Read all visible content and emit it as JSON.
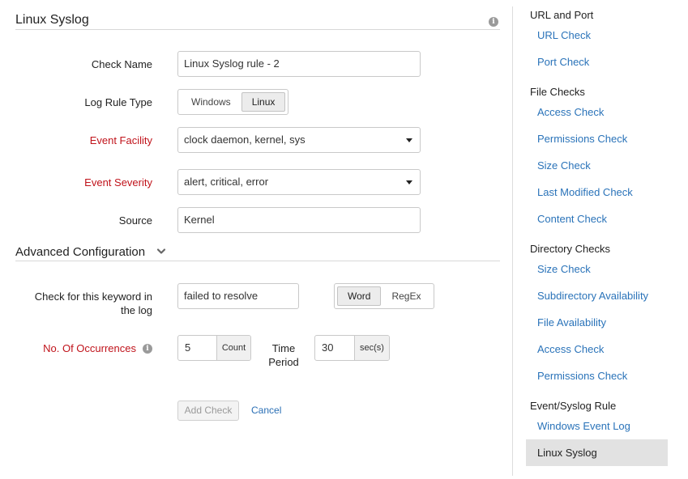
{
  "form": {
    "title": "Linux Syslog",
    "check_name_label": "Check Name",
    "check_name_value": "Linux Syslog rule - 2",
    "log_rule_type_label": "Log Rule Type",
    "log_rule_type_options": [
      "Windows",
      "Linux"
    ],
    "log_rule_type_selected": "Linux",
    "event_facility_label": "Event Facility",
    "event_facility_value": "clock daemon, kernel, sys",
    "event_severity_label": "Event Severity",
    "event_severity_value": "alert, critical, error",
    "source_label": "Source",
    "source_value": "Kernel"
  },
  "advanced": {
    "title": "Advanced Configuration",
    "keyword_label_line1": "Check for this keyword in",
    "keyword_label_line2": "the log",
    "keyword_value": "failed to resolve",
    "match_mode_options": [
      "Word",
      "RegEx"
    ],
    "match_mode_selected": "Word",
    "occurrences_label": "No. Of Occurrences",
    "occurrences_value": "5",
    "occurrences_unit": "Count",
    "time_period_label_line1": "Time",
    "time_period_label_line2": "Period",
    "time_period_value": "30",
    "time_period_unit": "sec(s)"
  },
  "actions": {
    "add_check": "Add Check",
    "cancel": "Cancel"
  },
  "sidebar": {
    "groups": [
      {
        "heading": "URL and Port",
        "items": [
          "URL Check",
          "Port Check"
        ]
      },
      {
        "heading": "File Checks",
        "items": [
          "Access Check",
          "Permissions Check",
          "Size Check",
          "Last Modified Check",
          "Content Check"
        ]
      },
      {
        "heading": "Directory Checks",
        "items": [
          "Size Check",
          "Subdirectory Availability",
          "File Availability",
          "Access Check",
          "Permissions Check"
        ]
      },
      {
        "heading": "Event/Syslog Rule",
        "items": [
          "Windows Event Log",
          "Linux Syslog"
        ]
      }
    ],
    "active_item": "Linux Syslog"
  },
  "colors": {
    "required_label": "#c0131b",
    "link": "#2a73b9",
    "active_bg": "#e2e2e2"
  },
  "icons": {
    "title_info": "info-icon",
    "occurrences_info": "info-icon",
    "advanced_toggle": "chevron-down-icon",
    "select_caret": "caret-down-icon"
  }
}
